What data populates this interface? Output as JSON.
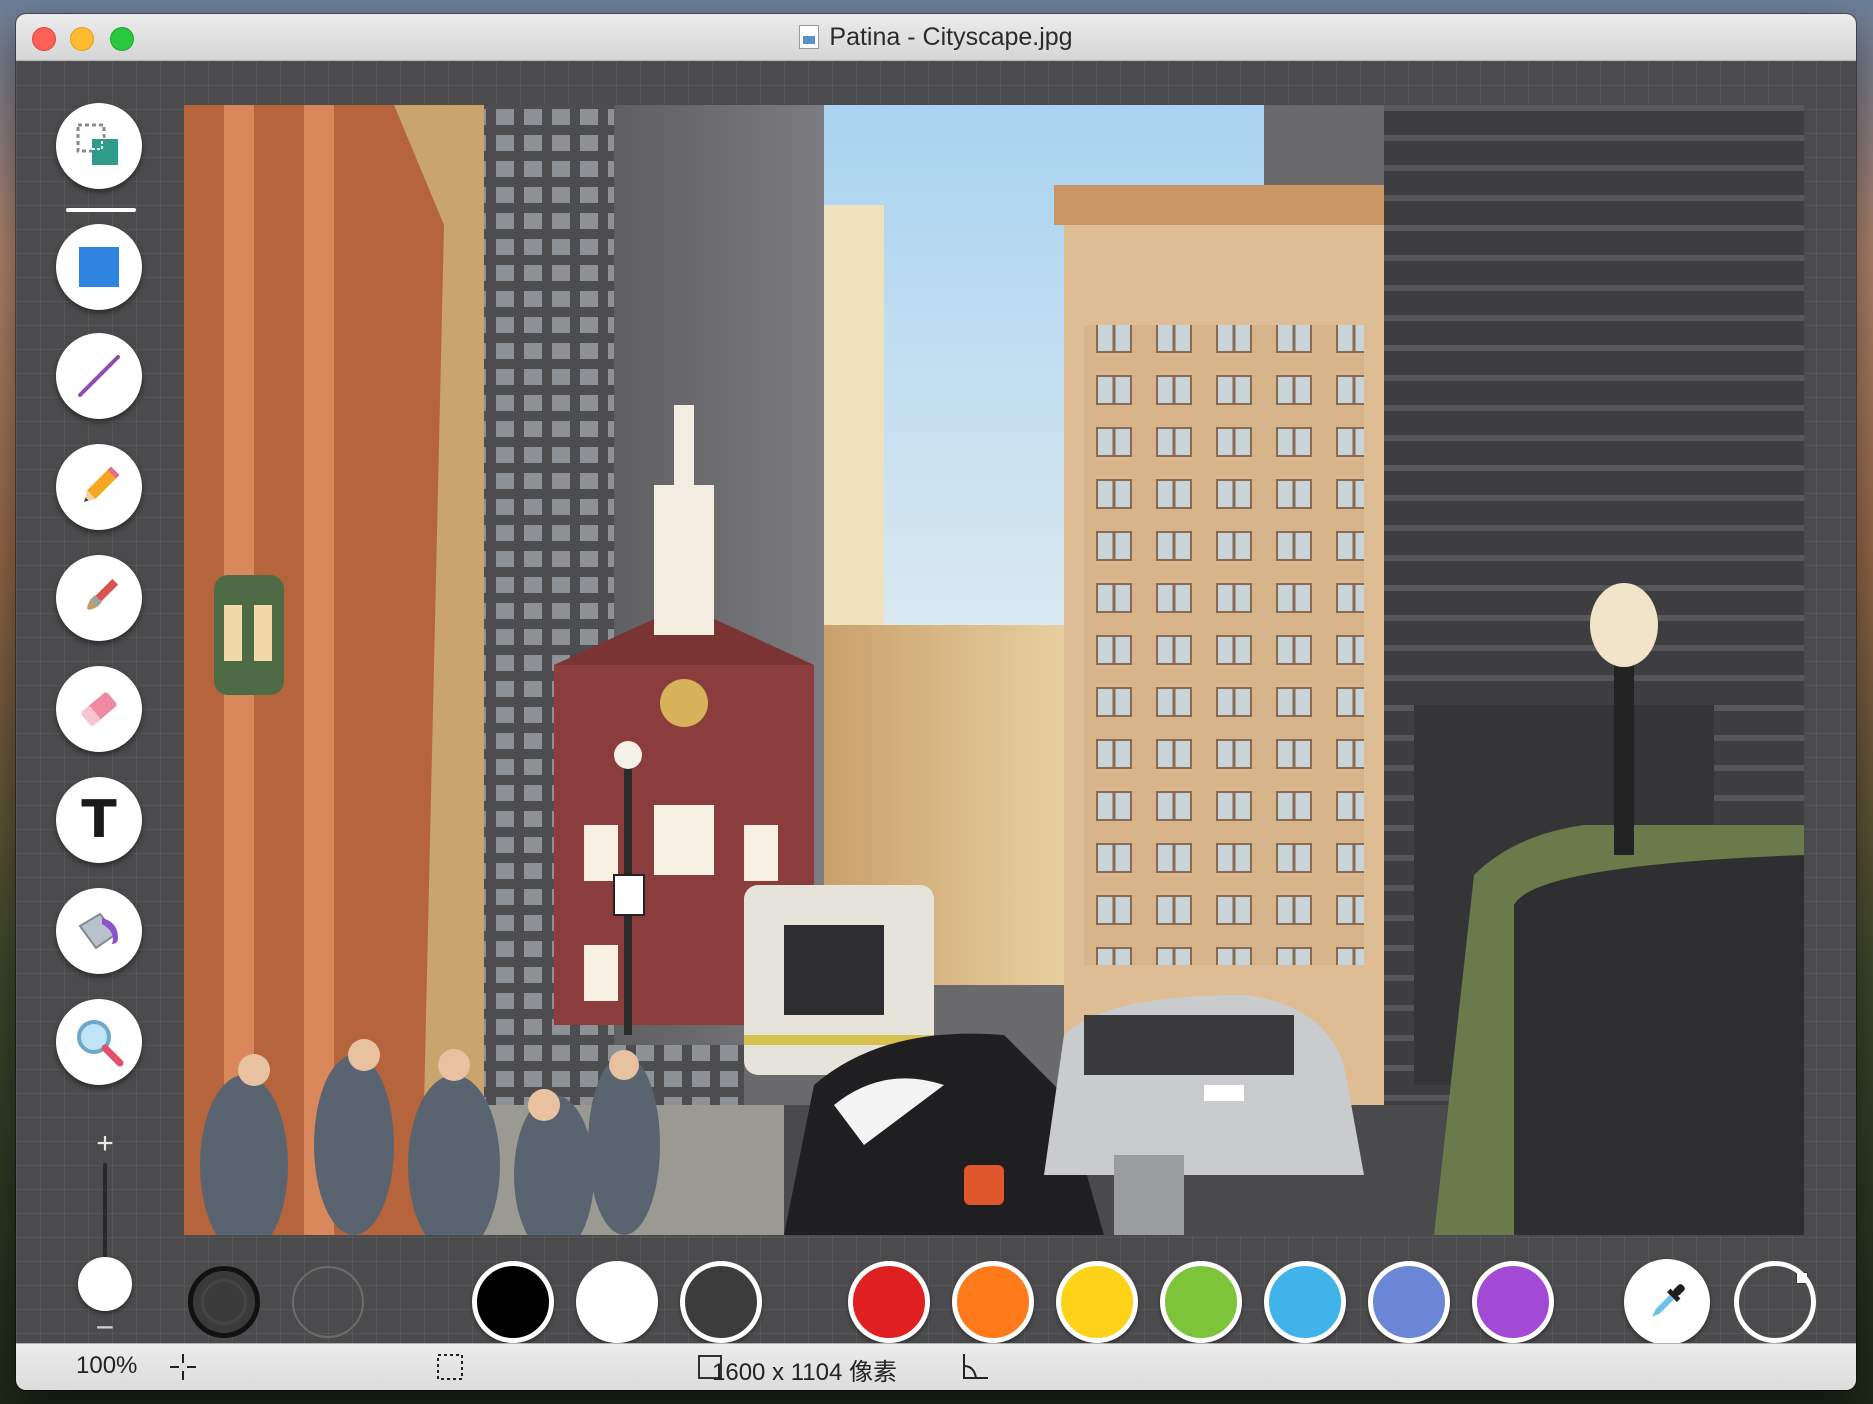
{
  "window": {
    "title": "Patina - Cityscape.jpg"
  },
  "tools": [
    {
      "name": "selection-tool",
      "icon": "selection-icon",
      "selected": true
    },
    {
      "name": "rectangle-tool",
      "icon": "rectangle-icon"
    },
    {
      "name": "line-tool",
      "icon": "line-icon"
    },
    {
      "name": "pencil-tool",
      "icon": "pencil-icon"
    },
    {
      "name": "brush-tool",
      "icon": "brush-icon"
    },
    {
      "name": "eraser-tool",
      "icon": "eraser-icon"
    },
    {
      "name": "text-tool",
      "icon": "text-icon",
      "glyph": "T"
    },
    {
      "name": "fill-tool",
      "icon": "paint-bucket-icon"
    },
    {
      "name": "zoom-tool",
      "icon": "magnifier-icon"
    }
  ],
  "zoom_slider": {
    "plus": "+",
    "minus": "−"
  },
  "palette": {
    "stroke_selected": "#111111",
    "swatches": [
      {
        "name": "black",
        "color": "#000000"
      },
      {
        "name": "white",
        "color": "#ffffff"
      },
      {
        "name": "dark-gray",
        "color": "#3c3c3c"
      },
      {
        "name": "red",
        "color": "#e02020"
      },
      {
        "name": "orange",
        "color": "#ff7a1a"
      },
      {
        "name": "yellow",
        "color": "#ffd21a"
      },
      {
        "name": "green",
        "color": "#7ec43a"
      },
      {
        "name": "sky-blue",
        "color": "#3fb3ea"
      },
      {
        "name": "periwinkle",
        "color": "#6a86d4"
      },
      {
        "name": "purple",
        "color": "#a24ad6"
      }
    ]
  },
  "status": {
    "zoom": "100%",
    "dimensions": "1600 x 1104 像素"
  }
}
